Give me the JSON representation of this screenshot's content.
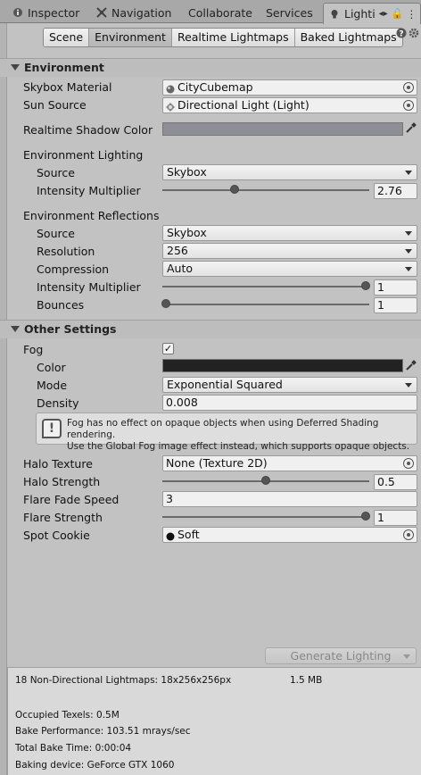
{
  "tabs": [
    {
      "label": "Inspector",
      "icon": "info-icon"
    },
    {
      "label": "Navigation",
      "icon": "navigation-icon"
    },
    {
      "label": "Collaborate",
      "icon": ""
    },
    {
      "label": "Services",
      "icon": ""
    },
    {
      "label": "Lighti",
      "icon": "lightbulb-icon"
    }
  ],
  "subtabs": [
    "Scene",
    "Environment",
    "Realtime Lightmaps",
    "Baked Lightmaps"
  ],
  "selected_subtab": "Environment",
  "environment": {
    "header": "Environment",
    "skybox_material_label": "Skybox Material",
    "skybox_material_value": "CityCubemap",
    "sun_source_label": "Sun Source",
    "sun_source_value": "Directional Light (Light)",
    "realtime_shadow_color_label": "Realtime Shadow Color",
    "realtime_shadow_color": "#8e8e96",
    "env_lighting_label": "Environment Lighting",
    "lighting_source_label": "Source",
    "lighting_source_value": "Skybox",
    "lighting_intensity_label": "Intensity Multiplier",
    "lighting_intensity_value": "2.76",
    "env_reflections_label": "Environment Reflections",
    "reflections_source_label": "Source",
    "reflections_source_value": "Skybox",
    "resolution_label": "Resolution",
    "resolution_value": "256",
    "compression_label": "Compression",
    "compression_value": "Auto",
    "reflections_intensity_label": "Intensity Multiplier",
    "reflections_intensity_value": "1",
    "bounces_label": "Bounces",
    "bounces_value": "1"
  },
  "other": {
    "header": "Other Settings",
    "fog_label": "Fog",
    "fog_checked": "✓",
    "color_label": "Color",
    "fog_color": "#222222",
    "mode_label": "Mode",
    "mode_value": "Exponential Squared",
    "density_label": "Density",
    "density_value": "0.008",
    "help_line1": "Fog has no effect on opaque objects when using Deferred Shading rendering.",
    "help_line2": "Use the Global Fog image effect instead, which supports opaque objects.",
    "halo_texture_label": "Halo Texture",
    "halo_texture_value": "None (Texture 2D)",
    "halo_strength_label": "Halo Strength",
    "halo_strength_value": "0.5",
    "flare_fade_label": "Flare Fade Speed",
    "flare_fade_value": "3",
    "flare_strength_label": "Flare Strength",
    "flare_strength_value": "1",
    "spot_cookie_label": "Spot Cookie",
    "spot_cookie_value": "Soft"
  },
  "generate_label": "Generate Lighting",
  "stats": {
    "lightmaps": "18 Non-Directional Lightmaps: 18x256x256px",
    "lightmaps_size": "1.5 MB",
    "occupied": "Occupied Texels: 0.5M",
    "performance": "Bake Performance: 103.51 mrays/sec",
    "total_time": "Total Bake Time: 0:00:04",
    "device": "Baking device: GeForce GTX 1060"
  }
}
